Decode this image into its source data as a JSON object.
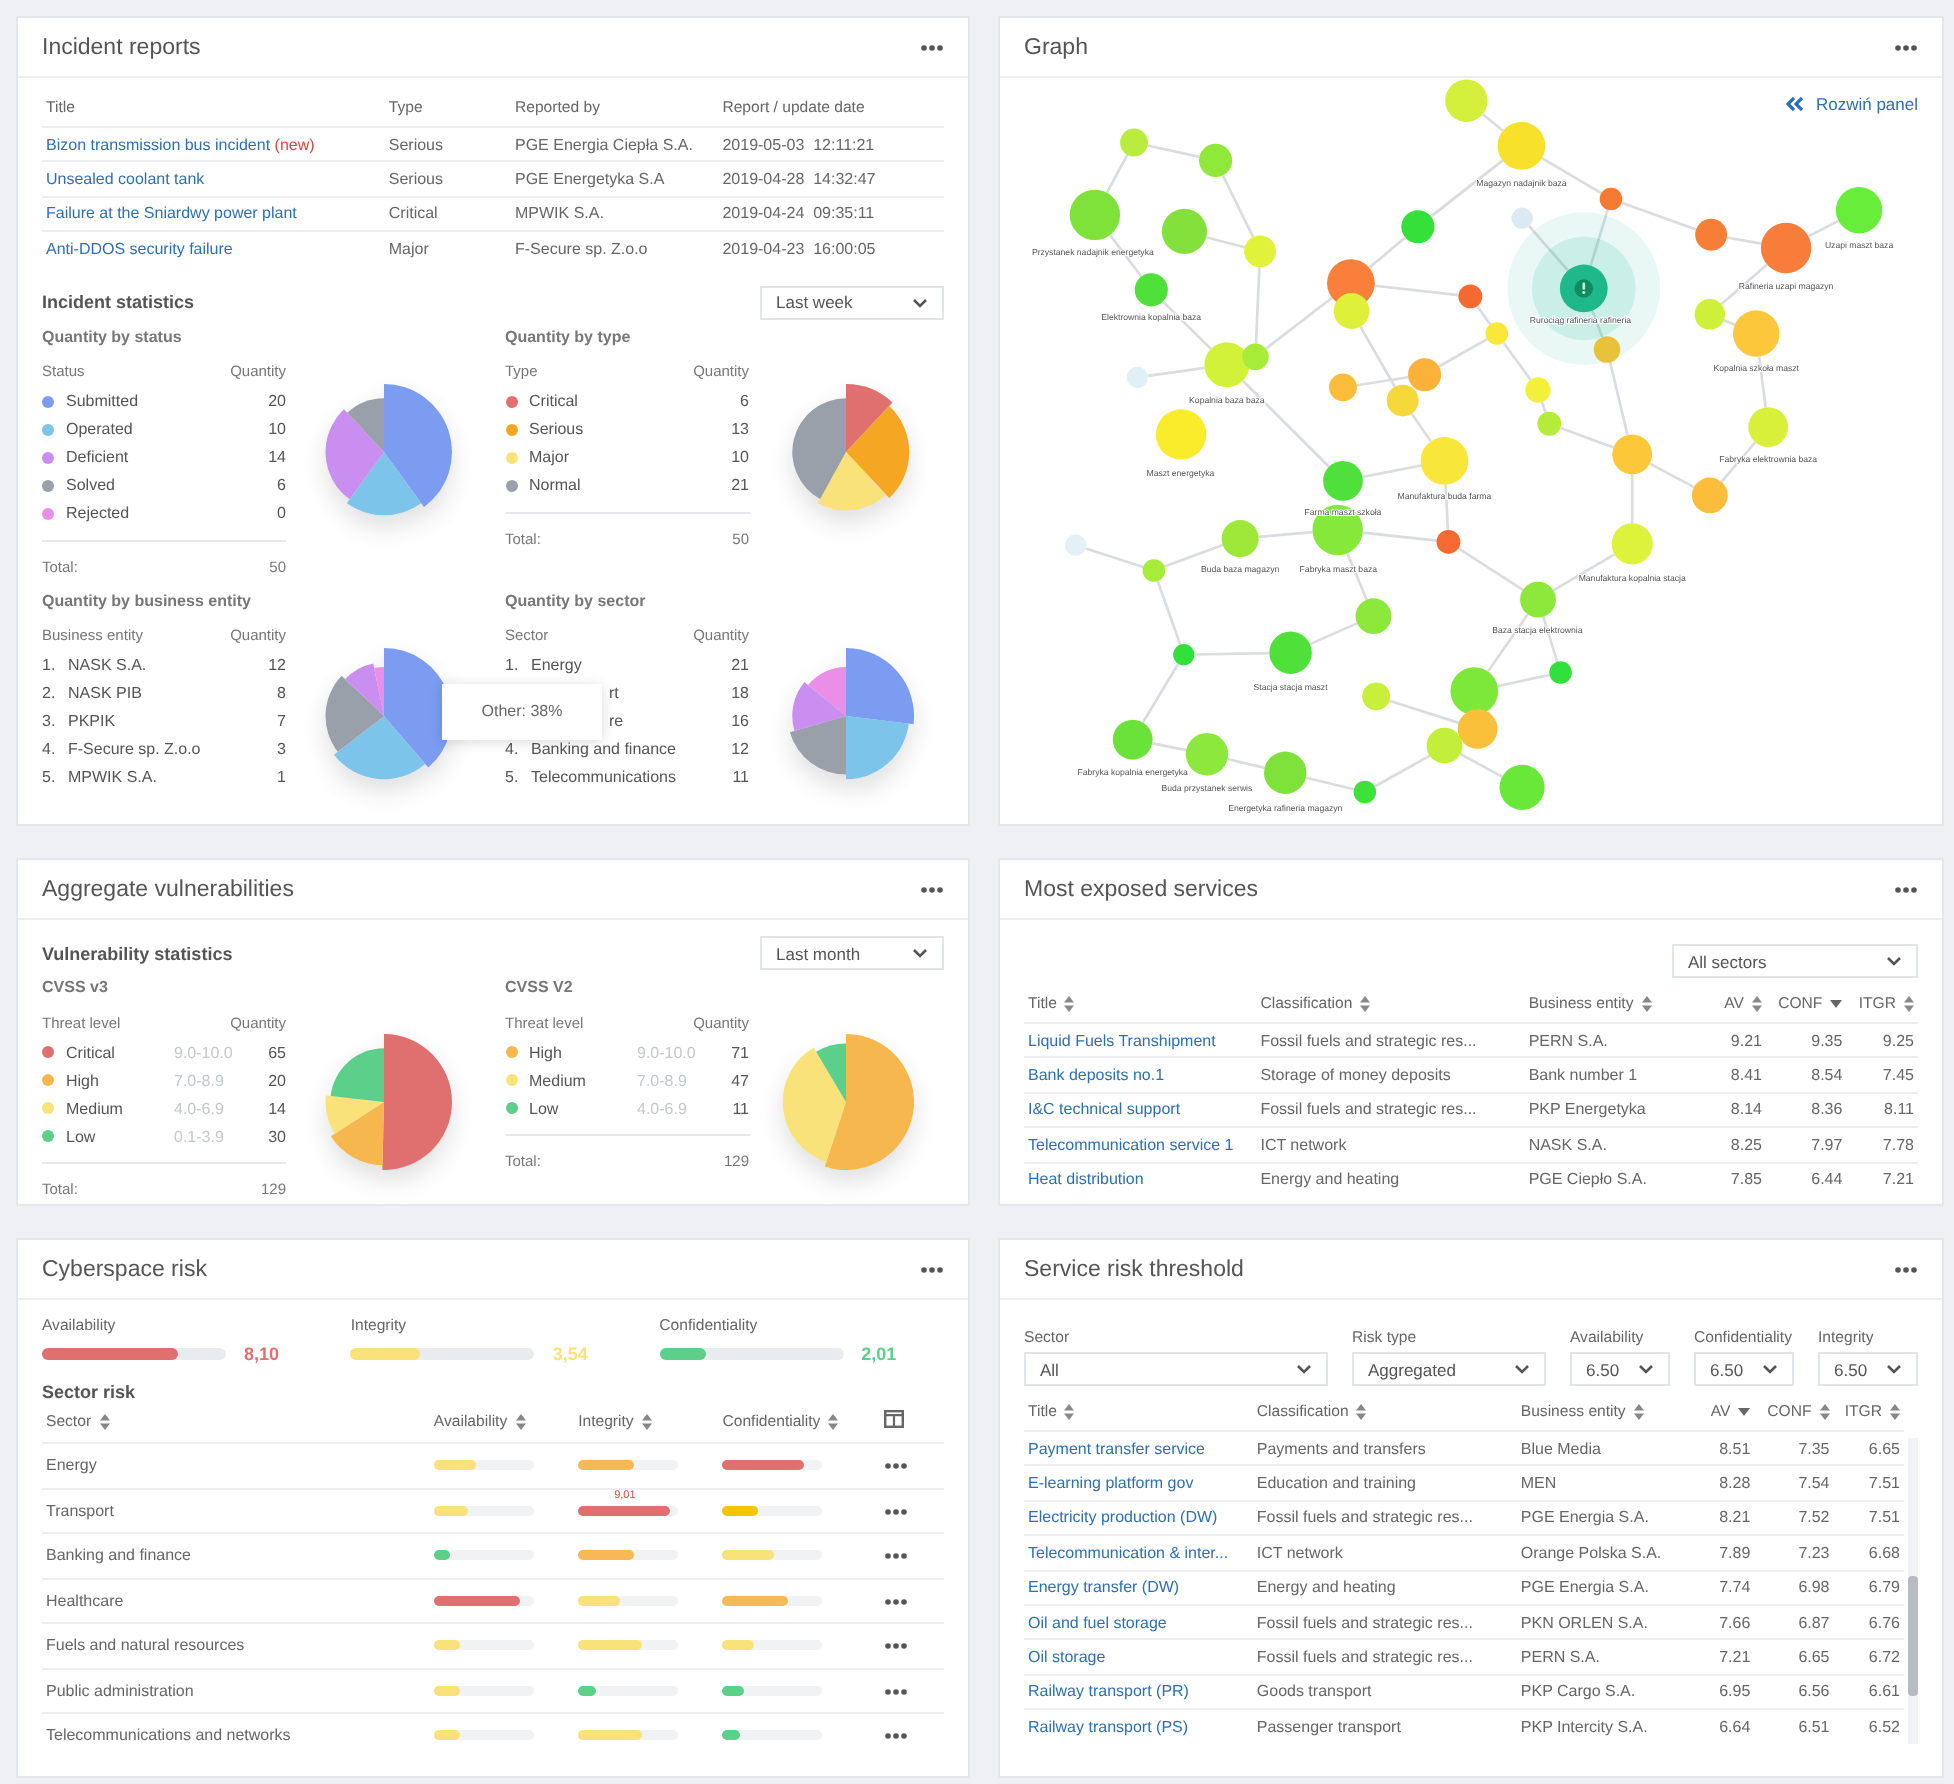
{
  "incident_reports": {
    "title": "Incident reports",
    "columns": [
      "Title",
      "Type",
      "Reported by",
      "Report / update date"
    ],
    "rows": [
      {
        "title": "Bizon transmission bus incident",
        "badge": "(new)",
        "type": "Serious",
        "reported_by": "PGE Energia Ciepła S.A.",
        "date": "2019-05-03  12:11:21"
      },
      {
        "title": "Unsealed coolant tank",
        "type": "Serious",
        "reported_by": "PGE Energetyka S.A",
        "date": "2019-04-28  14:32:47"
      },
      {
        "title": "Failure at the Sniardwy power plant",
        "type": "Critical",
        "reported_by": "MPWIK S.A.",
        "date": "2019-04-24  09:35:11"
      },
      {
        "title": "Anti-DDOS security failure",
        "type": "Major",
        "reported_by": "F-Secure sp. Z.o.o",
        "date": "2019-04-23  16:00:05"
      }
    ],
    "statistics_title": "Incident statistics",
    "period": "Last week",
    "blocks": [
      {
        "title": "Quantity by status",
        "columns": [
          "Status",
          "Quantity"
        ],
        "items": [
          {
            "name": "Submitted",
            "color": "#7b9cf0",
            "quantity": "20"
          },
          {
            "name": "Operated",
            "color": "#7cc4ea",
            "quantity": "10"
          },
          {
            "name": "Deficient",
            "color": "#c98ef0",
            "quantity": "14"
          },
          {
            "name": "Solved",
            "color": "#9aa0aa",
            "quantity": "6"
          },
          {
            "name": "Rejected",
            "color": "#e98fe8",
            "quantity": "0"
          }
        ],
        "total_label": "Total:",
        "total": "50"
      },
      {
        "title": "Quantity by type",
        "columns": [
          "Type",
          "Quantity"
        ],
        "items": [
          {
            "name": "Critical",
            "color": "#e07070",
            "quantity": "6"
          },
          {
            "name": "Serious",
            "color": "#f5a623",
            "quantity": "13"
          },
          {
            "name": "Major",
            "color": "#f9e27a",
            "quantity": "10"
          },
          {
            "name": "Normal",
            "color": "#9aa0aa",
            "quantity": "21"
          }
        ],
        "total_label": "Total:",
        "total": "50"
      },
      {
        "title": "Quantity by business entity",
        "columns": [
          "Business entity",
          "Quantity"
        ],
        "tooltip": "Other: 38%",
        "items": [
          {
            "kind": "full",
            "rank": "1.",
            "name": "NASK S.A.",
            "quantity": "12"
          },
          {
            "kind": "full",
            "rank": "2.",
            "name": "NASK PIB",
            "quantity": "8"
          },
          {
            "kind": "full",
            "rank": "3.",
            "name": "PKPIK",
            "quantity": "7"
          },
          {
            "kind": "full",
            "rank": "4.",
            "name": "F-Secure sp. Z.o.o",
            "quantity": "3"
          },
          {
            "kind": "full",
            "rank": "5.",
            "name": "MPWIK S.A.",
            "quantity": "1"
          }
        ]
      },
      {
        "title": "Quantity by sector",
        "columns": [
          "Sector",
          "Quantity"
        ],
        "items": [
          {
            "kind": "full",
            "rank": "1.",
            "name": "Energy",
            "quantity": "21"
          },
          {
            "kind": "cut",
            "name": "rt",
            "quantity": "18"
          },
          {
            "kind": "cut",
            "name": "re",
            "quantity": "16"
          },
          {
            "kind": "full",
            "rank": "4.",
            "name": "Banking and finance",
            "quantity": "12"
          },
          {
            "kind": "full",
            "rank": "5.",
            "name": "Telecommunications",
            "quantity": "11"
          }
        ]
      }
    ]
  },
  "graph": {
    "title": "Graph",
    "expand_link": "Rozwiń panel",
    "nodes": [
      {
        "color": "#d4f03c",
        "selected": false
      },
      {
        "color": "#f7e12a",
        "selected": false
      },
      {
        "color": "#b8ec3e",
        "selected": false
      },
      {
        "color": "#8fe83a",
        "selected": false
      },
      {
        "color": "#7ee23a",
        "selected": false
      },
      {
        "color": "#84e03a",
        "selected": false
      },
      {
        "color": "#e0f23a",
        "selected": false
      },
      {
        "color": "#f97f3a",
        "selected": false
      },
      {
        "color": "#35e03a",
        "selected": false
      },
      {
        "color": "#f46a32",
        "selected": false
      },
      {
        "color": "#dde9f2",
        "selected": false
      },
      {
        "color": "#f57a30",
        "selected": false
      },
      {
        "color": "#f67e36",
        "selected": false
      },
      {
        "color": "#f97d3a",
        "selected": false
      },
      {
        "color": "#68ee3a",
        "selected": false
      },
      {
        "color": "#1fb88a",
        "selected": true
      },
      {
        "color": "#cff03a",
        "selected": false
      },
      {
        "color": "#fcc73a",
        "selected": false
      },
      {
        "color": "#4fe03a",
        "selected": false
      },
      {
        "color": "#d2f23a",
        "selected": false
      },
      {
        "color": "#a8ec3a",
        "selected": false
      },
      {
        "color": "#dff03a",
        "selected": false
      },
      {
        "color": "#e0f0f6",
        "selected": false
      },
      {
        "color": "#f9ec2a",
        "selected": false
      },
      {
        "color": "#f9e83a",
        "selected": false
      },
      {
        "color": "#fbb23a",
        "selected": false
      },
      {
        "color": "#fbbd3a",
        "selected": false
      },
      {
        "color": "#f5d83a",
        "selected": false
      },
      {
        "color": "#e8c23a",
        "selected": false
      },
      {
        "color": "#f1f03a",
        "selected": false
      },
      {
        "color": "#b5ec3a",
        "selected": false
      },
      {
        "color": "#fcc83a",
        "selected": false
      },
      {
        "color": "#d9f03a",
        "selected": false
      },
      {
        "color": "#fbbd3b",
        "selected": false
      },
      {
        "color": "#f9e63a",
        "selected": false
      },
      {
        "color": "#4fe03b",
        "selected": false
      },
      {
        "color": "#86e83a",
        "selected": false
      },
      {
        "color": "#9ee83a",
        "selected": false
      },
      {
        "color": "#e4f0f6",
        "selected": false
      },
      {
        "color": "#a8ec3b",
        "selected": false
      },
      {
        "color": "#f56a32",
        "selected": false
      },
      {
        "color": "#ddf23a",
        "selected": false
      },
      {
        "color": "#8ce83a",
        "selected": false
      },
      {
        "color": "#8ce83b",
        "selected": false
      },
      {
        "color": "#50e03a",
        "selected": false
      },
      {
        "color": "#32e03a",
        "selected": false
      },
      {
        "color": "#32e03b",
        "selected": false
      },
      {
        "color": "#7ee83a",
        "selected": false
      },
      {
        "color": "#c8f03a",
        "selected": false
      },
      {
        "color": "#fbc03a",
        "selected": false
      },
      {
        "color": "#c2f03a",
        "selected": false
      },
      {
        "color": "#6ae23a",
        "selected": false
      },
      {
        "color": "#8ce83c",
        "selected": false
      },
      {
        "color": "#7ee23b",
        "selected": false
      },
      {
        "color": "#3ee03a",
        "selected": false
      },
      {
        "color": "#6ae83a",
        "selected": false
      }
    ],
    "labels": [
      {
        "text": "Przystanek nadajnik energetyka"
      },
      {
        "text": "Elektrownia kopalnia baza"
      },
      {
        "text": "Kopalnia baza baza"
      },
      {
        "text": "Maszt energetyka"
      },
      {
        "text": "Magazyn nadajnik baza"
      },
      {
        "text": "Rurociąg rafineria rafineria"
      },
      {
        "text": "Uzapi maszt baza"
      },
      {
        "text": "Rafineria uzapi magazyn"
      },
      {
        "text": "Kopalnia szkoła maszt"
      },
      {
        "text": "Fabryka elektrownia baza"
      },
      {
        "text": "Manufaktura buda farma"
      },
      {
        "text": "Farma maszt szkoła"
      },
      {
        "text": "Buda baza magazyn"
      },
      {
        "text": "Fabryka maszt baza"
      },
      {
        "text": "Manufaktura kopalnia stacja"
      },
      {
        "text": "Baza stacja elektrownia"
      },
      {
        "text": "Stacja stacja maszt"
      },
      {
        "text": "Fabryka kopalnia energetyka"
      },
      {
        "text": "Buda przystanek serwis"
      },
      {
        "text": "Energetyka rafineria magazyn"
      }
    ]
  },
  "aggregate_vulnerabilities": {
    "title": "Aggregate vulnerabilities",
    "subtitle": "Vulnerability statistics",
    "period": "Last month",
    "blocks": [
      {
        "title": "CVSS v3",
        "columns": [
          "Threat level",
          "Quantity"
        ],
        "items": [
          {
            "name": "Critical",
            "color": "#e07070",
            "range": "9.0-10.0",
            "quantity": "65"
          },
          {
            "name": "High",
            "color": "#f5b74e",
            "range": "7.0-8.9",
            "quantity": "20"
          },
          {
            "name": "Medium",
            "color": "#f9e27a",
            "range": "4.0-6.9",
            "quantity": "14"
          },
          {
            "name": "Low",
            "color": "#5ccf8a",
            "range": "0.1-3.9",
            "quantity": "30"
          }
        ],
        "total_label": "Total:",
        "total": "129"
      },
      {
        "title": "CVSS V2",
        "columns": [
          "Threat level",
          "Quantity"
        ],
        "items": [
          {
            "name": "High",
            "color": "#f5b74e",
            "range": "9.0-10.0",
            "quantity": "71"
          },
          {
            "name": "Medium",
            "color": "#f9e27a",
            "range": "7.0-8.9",
            "quantity": "47"
          },
          {
            "name": "Low",
            "color": "#5ccf8a",
            "range": "4.0-6.9",
            "quantity": "11"
          }
        ],
        "total_label": "Total:",
        "total": "129"
      }
    ]
  },
  "most_exposed_services": {
    "title": "Most exposed services",
    "filter": "All sectors",
    "columns": [
      {
        "label": "Title",
        "sorted_descending": false
      },
      {
        "label": "Classification",
        "sorted_descending": false
      },
      {
        "label": "Business entity",
        "sorted_descending": false
      },
      {
        "label": "AV",
        "sorted_descending": false
      },
      {
        "label": "CONF",
        "sorted_descending": true
      },
      {
        "label": "ITGR",
        "sorted_descending": false
      }
    ],
    "rows": [
      {
        "title": "Liquid Fuels Transhipment",
        "classification": "Fossil fuels and strategic res...",
        "entity": "PERN S.A.",
        "av": "9.21",
        "conf": "9.35",
        "itgr": "9.25"
      },
      {
        "title": "Bank deposits no.1",
        "classification": "Storage of money deposits",
        "entity": "Bank number 1",
        "av": "8.41",
        "conf": "8.54",
        "itgr": "7.45"
      },
      {
        "title": "I&C technical support",
        "classification": "Fossil fuels and strategic res...",
        "entity": "PKP Energetyka",
        "av": "8.14",
        "conf": "8.36",
        "itgr": "8.11"
      },
      {
        "title": "Telecommunication service 1",
        "classification": "ICT network",
        "entity": "NASK S.A.",
        "av": "8.25",
        "conf": "7.97",
        "itgr": "7.78"
      },
      {
        "title": "Heat distribution",
        "classification": "Energy and heating",
        "entity": "PGE Ciepło S.A.",
        "av": "7.85",
        "conf": "6.44",
        "itgr": "7.21"
      }
    ]
  },
  "cyberspace_risk": {
    "title": "Cyberspace risk",
    "meters": [
      {
        "label": "Availability",
        "level": 0.74,
        "reading": "8,10",
        "color": "#e07070"
      },
      {
        "label": "Integrity",
        "level": 0.38,
        "reading": "3,54",
        "color": "#f9e27a"
      },
      {
        "label": "Confidentiality",
        "level": 0.25,
        "reading": "2,01",
        "color": "#5ccf8a"
      }
    ],
    "subtitle": "Sector risk",
    "columns": [
      {
        "label": "Sector",
        "sorted_descending": false
      },
      {
        "label": "Availability",
        "sorted_descending": false
      },
      {
        "label": "Integrity",
        "sorted_descending": false
      },
      {
        "label": "Confidentiality",
        "sorted_descending": false
      }
    ],
    "rows": [
      {
        "sector": "Energy",
        "bars": [
          {
            "level": 0.43,
            "color": "#f9e27a"
          },
          {
            "level": 0.55,
            "color": "#f7b955"
          },
          {
            "level": 0.82,
            "color": "#e07070"
          }
        ]
      },
      {
        "sector": "Transport",
        "bars": [
          {
            "level": 0.35,
            "color": "#f9e27a"
          },
          {
            "level": 0.91,
            "color": "#e07070",
            "value_label": "9,01"
          },
          {
            "level": 0.35,
            "color": "#f2c500"
          }
        ]
      },
      {
        "sector": "Banking and finance",
        "bars": [
          {
            "level": 0.17,
            "color": "#5ccf8a"
          },
          {
            "level": 0.55,
            "color": "#f7b955"
          },
          {
            "level": 0.51,
            "color": "#f9e27a"
          }
        ]
      },
      {
        "sector": "Healthcare",
        "bars": [
          {
            "level": 0.86,
            "color": "#e07070"
          },
          {
            "level": 0.41,
            "color": "#f9e27a"
          },
          {
            "level": 0.66,
            "color": "#f7b955"
          }
        ]
      },
      {
        "sector": "Fuels and natural resources",
        "bars": [
          {
            "level": 0.26,
            "color": "#f9e27a"
          },
          {
            "level": 0.64,
            "color": "#f9e27a"
          },
          {
            "level": 0.32,
            "color": "#f9e27a"
          }
        ]
      },
      {
        "sector": "Public administration",
        "bars": [
          {
            "level": 0.26,
            "color": "#f9e27a"
          },
          {
            "level": 0.18,
            "color": "#5ccf8a"
          },
          {
            "level": 0.22,
            "color": "#5ccf8a"
          }
        ]
      },
      {
        "sector": "Telecommunications and networks",
        "bars": [
          {
            "level": 0.26,
            "color": "#f9e27a"
          },
          {
            "level": 0.64,
            "color": "#f9e27a"
          },
          {
            "level": 0.18,
            "color": "#5ccf8a"
          }
        ]
      }
    ]
  },
  "service_risk_threshold": {
    "title": "Service risk threshold",
    "filters": [
      {
        "label": "Sector",
        "value": "All"
      },
      {
        "label": "Risk type",
        "value": "Aggregated"
      },
      {
        "label": "Availability",
        "value": "6.50"
      },
      {
        "label": "Confidentiality",
        "value": "6.50"
      },
      {
        "label": "Integrity",
        "value": "6.50"
      }
    ],
    "columns": [
      {
        "label": "Title",
        "sorted_descending": false
      },
      {
        "label": "Classification",
        "sorted_descending": false
      },
      {
        "label": "Business entity",
        "sorted_descending": false
      },
      {
        "label": "AV",
        "sorted_descending": true
      },
      {
        "label": "CONF",
        "sorted_descending": false
      },
      {
        "label": "ITGR",
        "sorted_descending": false
      }
    ],
    "rows": [
      {
        "title": "Payment transfer service",
        "classification": "Payments and transfers",
        "entity": "Blue Media",
        "av": "8.51",
        "conf": "7.35",
        "itgr": "6.65"
      },
      {
        "title": "E-learning platform gov",
        "classification": "Education and training",
        "entity": "MEN",
        "av": "8.28",
        "conf": "7.54",
        "itgr": "7.51"
      },
      {
        "title": "Electricity production (DW)",
        "classification": "Fossil fuels and strategic res...",
        "entity": "PGE Energia S.A.",
        "av": "8.21",
        "conf": "7.52",
        "itgr": "7.51"
      },
      {
        "title": "Telecommunication & inter...",
        "classification": "ICT network",
        "entity": "Orange Polska S.A.",
        "av": "7.89",
        "conf": "7.23",
        "itgr": "6.68"
      },
      {
        "title": "Energy transfer (DW)",
        "classification": "Energy and heating",
        "entity": "PGE Energia S.A.",
        "av": "7.74",
        "conf": "6.98",
        "itgr": "6.79"
      },
      {
        "title": "Oil and fuel storage",
        "classification": "Fossil fuels and strategic res...",
        "entity": "PKN ORLEN S.A.",
        "av": "7.66",
        "conf": "6.87",
        "itgr": "6.76"
      },
      {
        "title": "Oil storage",
        "classification": "Fossil fuels and strategic res...",
        "entity": "PERN S.A.",
        "av": "7.21",
        "conf": "6.65",
        "itgr": "6.72"
      },
      {
        "title": "Railway transport (PR)",
        "classification": "Goods transport",
        "entity": "PKP Cargo S.A.",
        "av": "6.95",
        "conf": "6.56",
        "itgr": "6.61"
      },
      {
        "title": "Railway transport (PS)",
        "classification": "Passenger transport",
        "entity": "PKP Intercity S.A.",
        "av": "6.64",
        "conf": "6.51",
        "itgr": "6.52"
      }
    ]
  }
}
